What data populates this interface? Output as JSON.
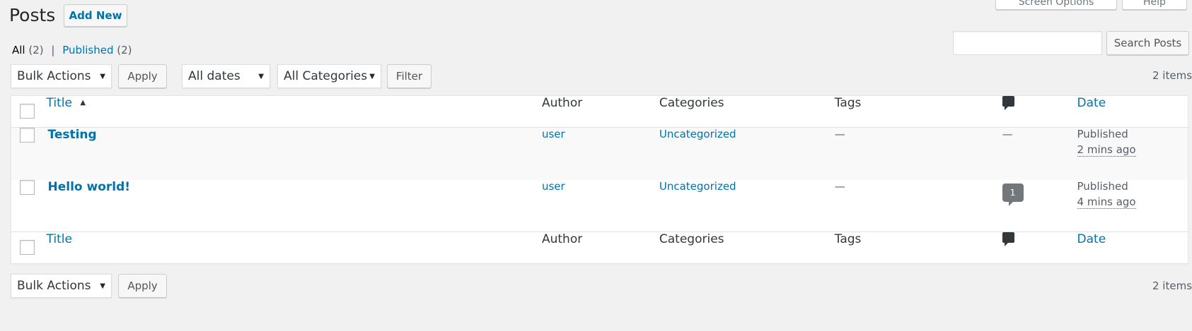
{
  "page": {
    "title": "Posts",
    "add_new": "Add New",
    "screen_options": "Screen Options",
    "help": "Help"
  },
  "views": {
    "all_label": "All",
    "all_count": "(2)",
    "separator": "|",
    "published_label": "Published",
    "published_count": "(2)"
  },
  "search": {
    "value": "",
    "button": "Search Posts"
  },
  "filters": {
    "bulk_actions": "Bulk Actions",
    "apply": "Apply",
    "dates": "All dates",
    "categories": "All Categories",
    "filter": "Filter",
    "items_count": "2 items"
  },
  "table": {
    "columns": {
      "title": "Title",
      "author": "Author",
      "categories": "Categories",
      "tags": "Tags",
      "comments_icon": "comment-icon",
      "date": "Date"
    },
    "rows": [
      {
        "title": "Testing",
        "author": "user",
        "categories": "Uncategorized",
        "tags": "—",
        "comments": "—",
        "date_status": "Published",
        "date_ago": "2 mins ago"
      },
      {
        "title": "Hello world!",
        "author": "user",
        "categories": "Uncategorized",
        "tags": "—",
        "comments": "1",
        "date_status": "Published",
        "date_ago": "4 mins ago"
      }
    ]
  },
  "bottom": {
    "bulk_actions": "Bulk Actions",
    "apply": "Apply",
    "items_count": "2 items"
  },
  "colors": {
    "link": "#0073aa",
    "background": "#f1f1f1",
    "text": "#32373c"
  }
}
